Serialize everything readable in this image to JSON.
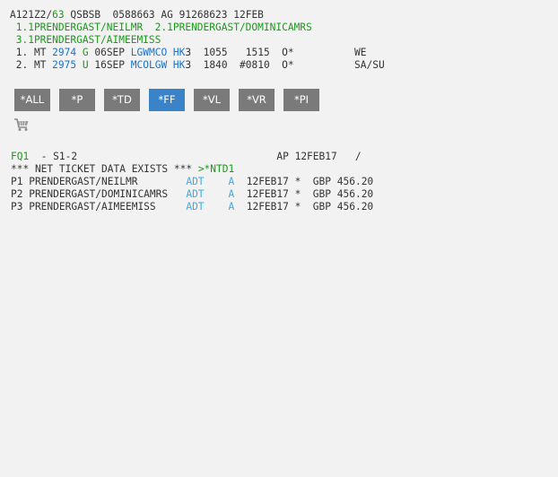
{
  "header": {
    "pnr_prefix": "A121Z2/",
    "pnr_number": "63",
    "pnr_rest": " QSBSB  0588663 AG 91268623 12FEB"
  },
  "names": {
    "line1_a": " 1.1PRENDERGAST/NEILMR  2.1PRENDERGAST/DOMINICAMRS",
    "line2_a": " 3.1PRENDERGAST/AIMEEMISS"
  },
  "segments": [
    {
      "num": " 1.",
      "carrier": " MT ",
      "flight": "2974",
      "class": " G ",
      "date": "06SEP ",
      "route": "LGWMCO",
      "status": " HK",
      "rest": "3  1055   1515  O*          WE"
    },
    {
      "num": " 2.",
      "carrier": " MT ",
      "flight": "2975",
      "class": " U ",
      "date": "16SEP ",
      "route": "MCOLGW",
      "status": " HK",
      "rest": "3  1840  #0810  O*          SA/SU"
    }
  ],
  "buttons": [
    {
      "label": "*ALL",
      "active": false
    },
    {
      "label": "*P",
      "active": false
    },
    {
      "label": "*TD",
      "active": false
    },
    {
      "label": "*FF",
      "active": true
    },
    {
      "label": "*VL",
      "active": false
    },
    {
      "label": "*VR",
      "active": false
    },
    {
      "label": "*PI",
      "active": false
    }
  ],
  "cart_icon": "shopping-cart-icon",
  "fare": {
    "fq_link": "FQ1",
    "fq_rest": "  - S1-2                                 AP 12FEB17   /",
    "net_text": "*** NET TICKET DATA EXISTS *** ",
    "net_link": ">*NTD1",
    "passengers": [
      {
        "p": "P1 PRENDERGAST/NEILMR        ",
        "ptc": "ADT",
        "mid": "    ",
        "a": "A",
        "rest": "  12FEB17 *  GBP 456.20"
      },
      {
        "p": "P2 PRENDERGAST/DOMINICAMRS   ",
        "ptc": "ADT",
        "mid": "    ",
        "a": "A",
        "rest": "  12FEB17 *  GBP 456.20"
      },
      {
        "p": "P3 PRENDERGAST/AIMEEMISS     ",
        "ptc": "ADT",
        "mid": "    ",
        "a": "A",
        "rest": "  12FEB17 *  GBP 456.20"
      }
    ]
  },
  "colors": {
    "green_link": "#1a9a1a",
    "blue_link": "#1a73c9",
    "light_blue": "#3fa9e0",
    "button_gray": "#7a7a7a",
    "button_active": "#3b83c9"
  }
}
